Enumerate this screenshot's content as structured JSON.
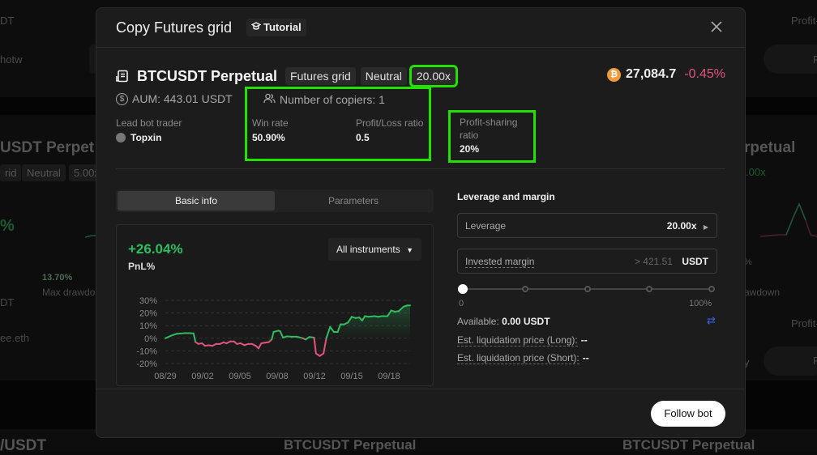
{
  "background": {
    "left_items": [
      "DT",
      "hotw",
      "USDT Perpet",
      "rid",
      "Neutral",
      "5.00x",
      "%",
      "13.70%",
      "Max drawdo",
      "DT",
      "ee.eth",
      "/USDT"
    ],
    "right_items": [
      "Profit-",
      "F",
      "rpetual",
      ".00x",
      "%",
      "awdown",
      "Profit-",
      "y",
      "F"
    ],
    "bottom_items": [
      "BTCUSDT Perpetual",
      "BTCUSDT Perpetual"
    ]
  },
  "modal": {
    "title": "Copy Futures grid",
    "tutorial_label": "Tutorial",
    "close_icon": "close-icon"
  },
  "bot": {
    "pair": "BTCUSDT Perpetual",
    "tags": [
      "Futures grid",
      "Neutral",
      "20.00x"
    ],
    "price": "27,084.7",
    "price_change": "-0.45%",
    "aum": "AUM: 443.01 USDT",
    "copiers": "Number of copiers: 1"
  },
  "stats": {
    "lead_trader_label": "Lead bot trader",
    "lead_trader_name": "Topxin",
    "win_rate_label": "Win rate",
    "win_rate": "50.90%",
    "pl_ratio_label": "Profit/Loss ratio",
    "pl_ratio": "0.5",
    "profit_sharing_label": "Profit-sharing ratio",
    "profit_sharing": "20%"
  },
  "tabs": [
    {
      "label": "Basic info",
      "active": true
    },
    {
      "label": "Parameters",
      "active": false
    }
  ],
  "pnl": {
    "value": "+26.04%",
    "label": "PnL%",
    "filter": "All instruments"
  },
  "chart_data": {
    "type": "line",
    "title": "PnL%",
    "ylabel": "",
    "xlabel": "",
    "ylim": [
      -20,
      30
    ],
    "yticks": [
      "30%",
      "20%",
      "10%",
      "0%",
      "-10%",
      "-20%"
    ],
    "ytick_values": [
      30,
      20,
      10,
      0,
      -10,
      -20
    ],
    "xticks": [
      "08/29",
      "09/02",
      "09/05",
      "09/08",
      "09/12",
      "09/15",
      "09/18"
    ],
    "xtick_positions": [
      0,
      4,
      7,
      10,
      14,
      17,
      20
    ],
    "xlim": [
      0,
      22
    ],
    "grid": true,
    "positive_color": "#2ebd5f",
    "negative_color": "#e0547d",
    "series": [
      {
        "name": "PnL%",
        "points": [
          [
            0,
            0
          ],
          [
            0.6,
            2
          ],
          [
            1.2,
            3.5
          ],
          [
            2,
            4
          ],
          [
            2.7,
            4
          ],
          [
            3.0,
            3.8
          ],
          [
            3.2,
            -3
          ],
          [
            3.5,
            -4.5
          ],
          [
            3.9,
            -4
          ],
          [
            4.2,
            -6
          ],
          [
            4.6,
            -5.5
          ],
          [
            5.0,
            -6
          ],
          [
            5.4,
            -4.5
          ],
          [
            5.8,
            -4.5
          ],
          [
            6.2,
            -3.2
          ],
          [
            6.5,
            -4
          ],
          [
            6.9,
            -2.5
          ],
          [
            7.3,
            -2.5
          ],
          [
            7.6,
            -4.5
          ],
          [
            8.0,
            -4
          ],
          [
            8.4,
            -5.5
          ],
          [
            8.8,
            -4.5
          ],
          [
            9.2,
            -4.5
          ],
          [
            9.6,
            -6
          ],
          [
            9.9,
            -8
          ],
          [
            10.2,
            -4
          ],
          [
            10.6,
            -3.5
          ],
          [
            11.0,
            -3
          ],
          [
            11.3,
            -1
          ],
          [
            11.5,
            5
          ],
          [
            12.0,
            6
          ],
          [
            12.2,
            5.5
          ],
          [
            12.5,
            0.5
          ],
          [
            12.9,
            1.5
          ],
          [
            13.4,
            1.2
          ],
          [
            14.0,
            1.2
          ],
          [
            14.6,
            0
          ],
          [
            14.9,
            -1
          ],
          [
            15.3,
            1
          ],
          [
            15.8,
            0.5
          ],
          [
            16.0,
            -12
          ],
          [
            16.4,
            -14
          ],
          [
            16.8,
            -12
          ],
          [
            17.1,
            0
          ],
          [
            17.5,
            9
          ],
          [
            17.9,
            5
          ],
          [
            18.3,
            5
          ],
          [
            18.6,
            11
          ],
          [
            19.0,
            11
          ],
          [
            19.4,
            12.5
          ],
          [
            19.8,
            17
          ],
          [
            20.2,
            16
          ],
          [
            20.6,
            16.5
          ],
          [
            20.9,
            14
          ],
          [
            21.2,
            17.5
          ],
          [
            21.6,
            17
          ],
          [
            22.2,
            17.5
          ],
          [
            22.6,
            17
          ],
          [
            23.0,
            17.5
          ],
          [
            23.6,
            17.5
          ],
          [
            24.0,
            22
          ],
          [
            24.4,
            21
          ],
          [
            24.8,
            21.5
          ],
          [
            25.3,
            25
          ],
          [
            25.7,
            26
          ],
          [
            26.0,
            26
          ]
        ]
      }
    ]
  },
  "leverage_margin": {
    "title": "Leverage and margin",
    "leverage_label": "Leverage",
    "leverage_value": "20.00x",
    "margin_label": "Invested margin",
    "margin_hint": "> 421.51",
    "margin_unit": "USDT",
    "slider_value_percent": 0,
    "slider_min_label": "0",
    "slider_max_label": "100%",
    "available_label": "Available:",
    "available_value": "0.00 USDT",
    "liq_long_label": "Est. liquidation price (Long):",
    "liq_long_value": "--",
    "liq_short_label": "Est. liquidation price (Short):",
    "liq_short_value": "--"
  },
  "footer": {
    "follow_label": "Follow bot"
  }
}
